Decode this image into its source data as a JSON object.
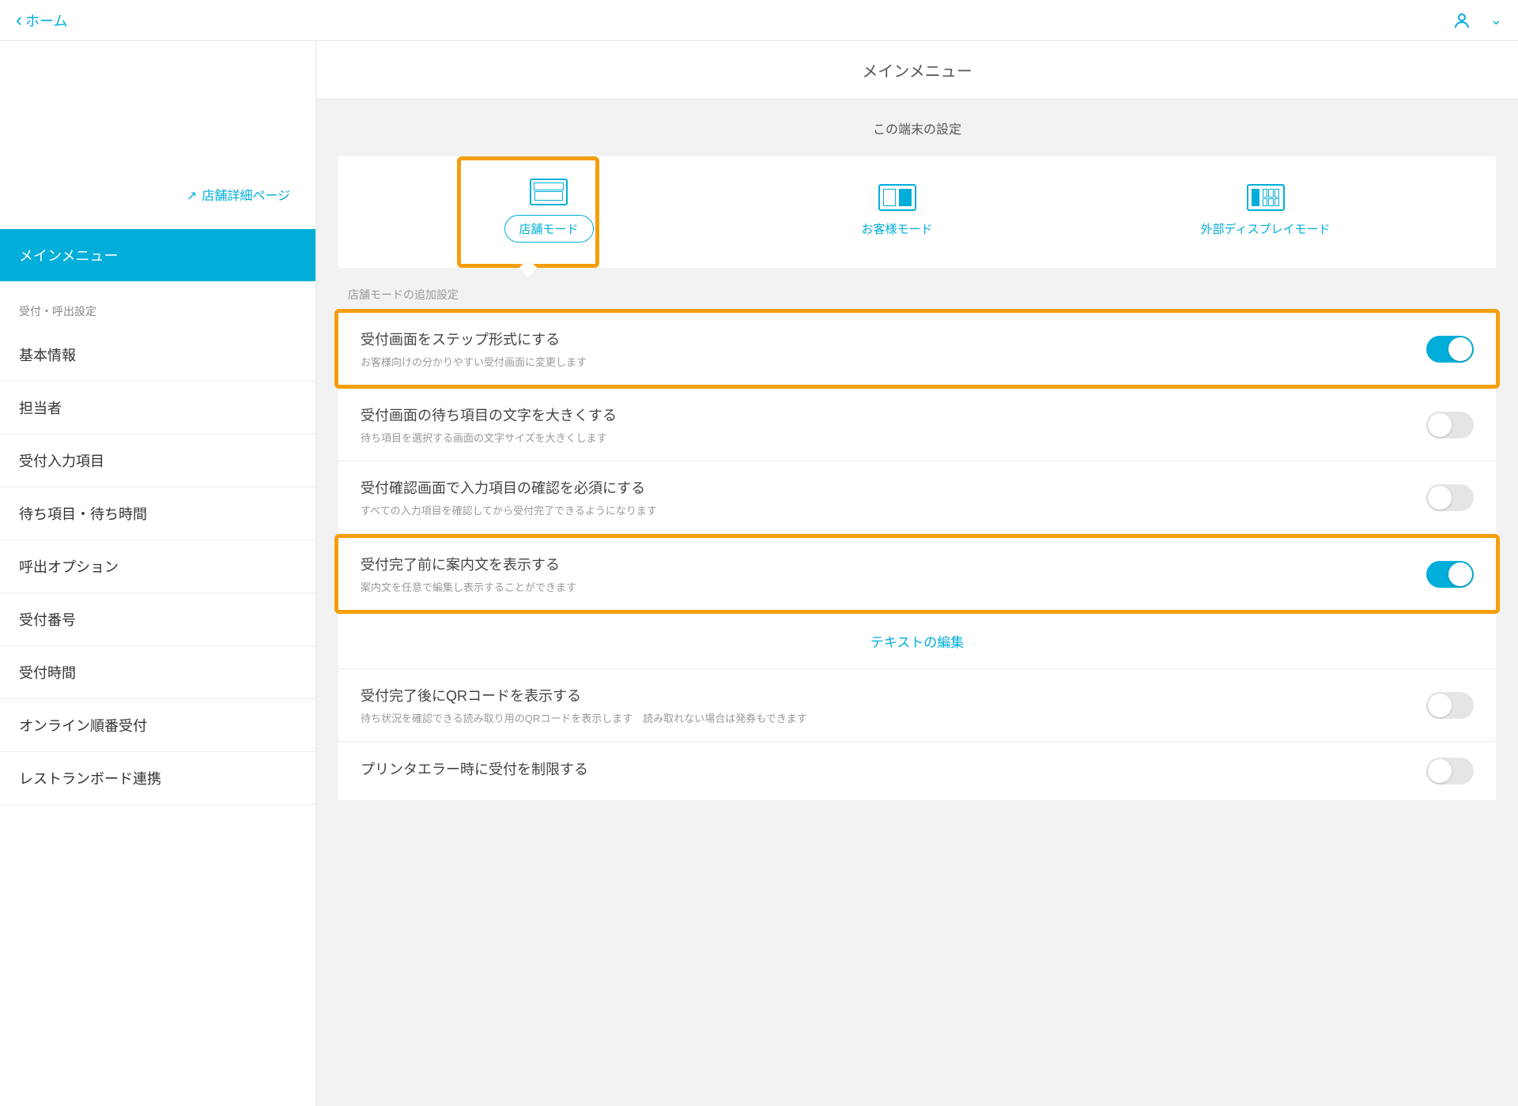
{
  "header": {
    "back_label": "ホーム"
  },
  "sidebar": {
    "detail_link": "店舗詳細ページ",
    "active": "メインメニュー",
    "section_label": "受付・呼出設定",
    "items": [
      "基本情報",
      "担当者",
      "受付入力項目",
      "待ち項目・待ち時間",
      "呼出オプション",
      "受付番号",
      "受付時間",
      "オンライン順番受付",
      "レストランボード連携"
    ]
  },
  "main": {
    "title": "メインメニュー",
    "device_section": "この端末の設定",
    "modes": {
      "store": "店舗モード",
      "customer": "お客様モード",
      "display": "外部ディスプレイモード"
    },
    "subsection": "店舗モードの追加設定",
    "settings": [
      {
        "title": "受付画面をステップ形式にする",
        "desc": "お客様向けの分かりやすい受付画面に変更します",
        "on": true,
        "highlighted": true
      },
      {
        "title": "受付画面の待ち項目の文字を大きくする",
        "desc": "待ち項目を選択する画面の文字サイズを大きくします",
        "on": false,
        "highlighted": false
      },
      {
        "title": "受付確認画面で入力項目の確認を必須にする",
        "desc": "すべての入力項目を確認してから受付完了できるようになります",
        "on": false,
        "highlighted": false
      },
      {
        "title": "受付完了前に案内文を表示する",
        "desc": "案内文を任意で編集し表示することができます",
        "on": true,
        "highlighted": true
      }
    ],
    "edit_text_link": "テキストの編集",
    "settings2": [
      {
        "title": "受付完了後にQRコードを表示する",
        "desc": "待ち状況を確認できる読み取り用のQRコードを表示します　読み取れない場合は発券もできます",
        "on": false
      },
      {
        "title": "プリンタエラー時に受付を制限する",
        "desc": "",
        "on": false
      }
    ]
  }
}
